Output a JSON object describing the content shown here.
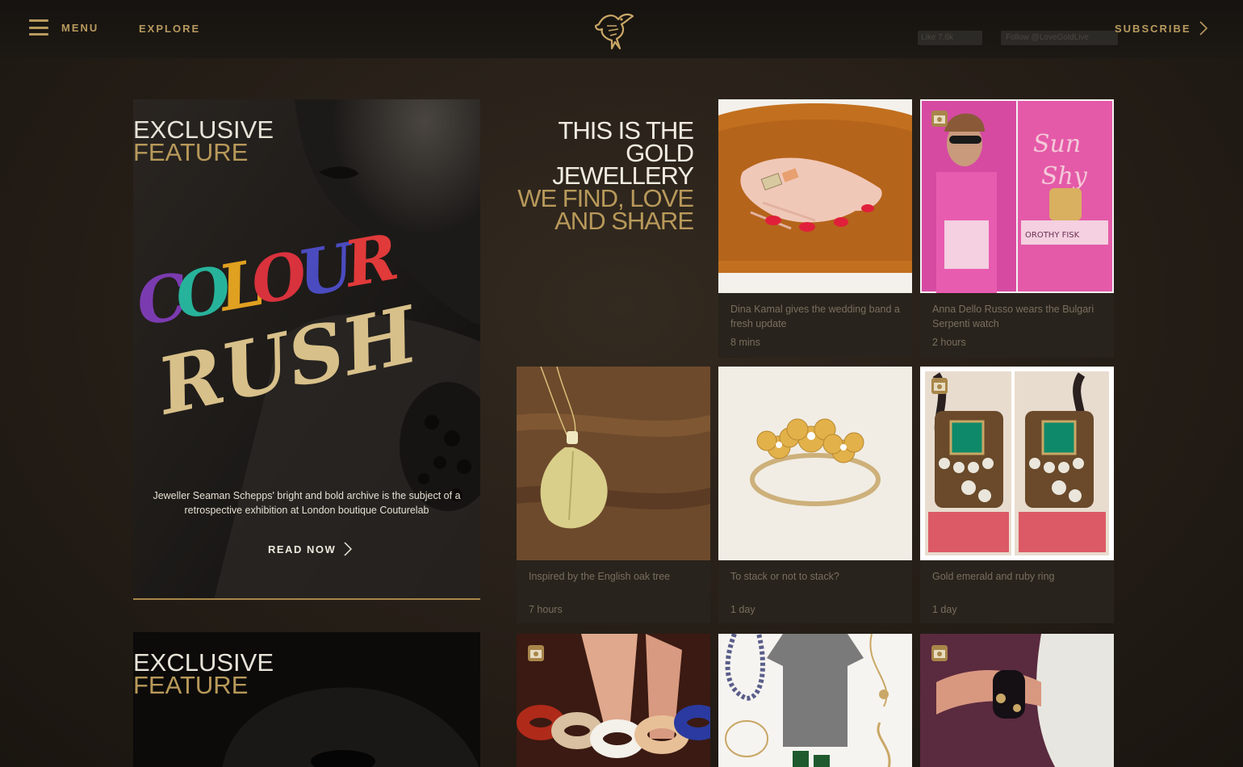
{
  "header": {
    "menu_label": "MENU",
    "explore_label": "EXPLORE",
    "subscribe_label": "SUBSCRIBE",
    "facebook_widget": "Like 7.6k",
    "twitter_widget": "Follow @LoveGoldLive"
  },
  "features": [
    {
      "line1": "EXCLUSIVE",
      "line2": "FEATURE",
      "artwork_text": [
        "COLOUR",
        "RUSH"
      ],
      "description": "Jeweller Seaman Schepps' bright and bold archive is the subject of a retrospective exhibition at London boutique Couturelab",
      "cta": "READ NOW"
    },
    {
      "line1": "EXCLUSIVE",
      "line2": "FEATURE"
    }
  ],
  "tagline": {
    "white_lines": [
      "THIS IS THE",
      "GOLD",
      "JEWELLERY"
    ],
    "gold_lines": [
      "WE FIND, LOVE",
      "AND SHARE"
    ]
  },
  "tiles": [
    {
      "caption": "Dina Kamal gives the wedding band a fresh update",
      "time": "8 mins",
      "instagram": false
    },
    {
      "caption": "Anna Dello Russo wears the Bulgari Serpenti watch",
      "time": "2 hours",
      "instagram": true
    },
    {
      "caption": "Inspired by the English oak tree",
      "time": "7 hours",
      "instagram": false
    },
    {
      "caption": "To stack or not to stack?",
      "time": "1 day",
      "instagram": false
    },
    {
      "caption": "Gold emerald and ruby ring",
      "time": "1 day",
      "instagram": true
    },
    {
      "caption": "",
      "time": "",
      "instagram": true
    },
    {
      "caption": "",
      "time": "",
      "instagram": false
    },
    {
      "caption": "",
      "time": "",
      "instagram": true
    }
  ],
  "colors": {
    "accent_gold": "#b89a5e",
    "tagline_white": "#f1ece2",
    "caption_grey": "#7a6f5f",
    "tile_bg": "#28231c"
  },
  "icons": [
    "hamburger-icon",
    "bird-logo-icon",
    "chevron-right-icon",
    "instagram-icon"
  ]
}
